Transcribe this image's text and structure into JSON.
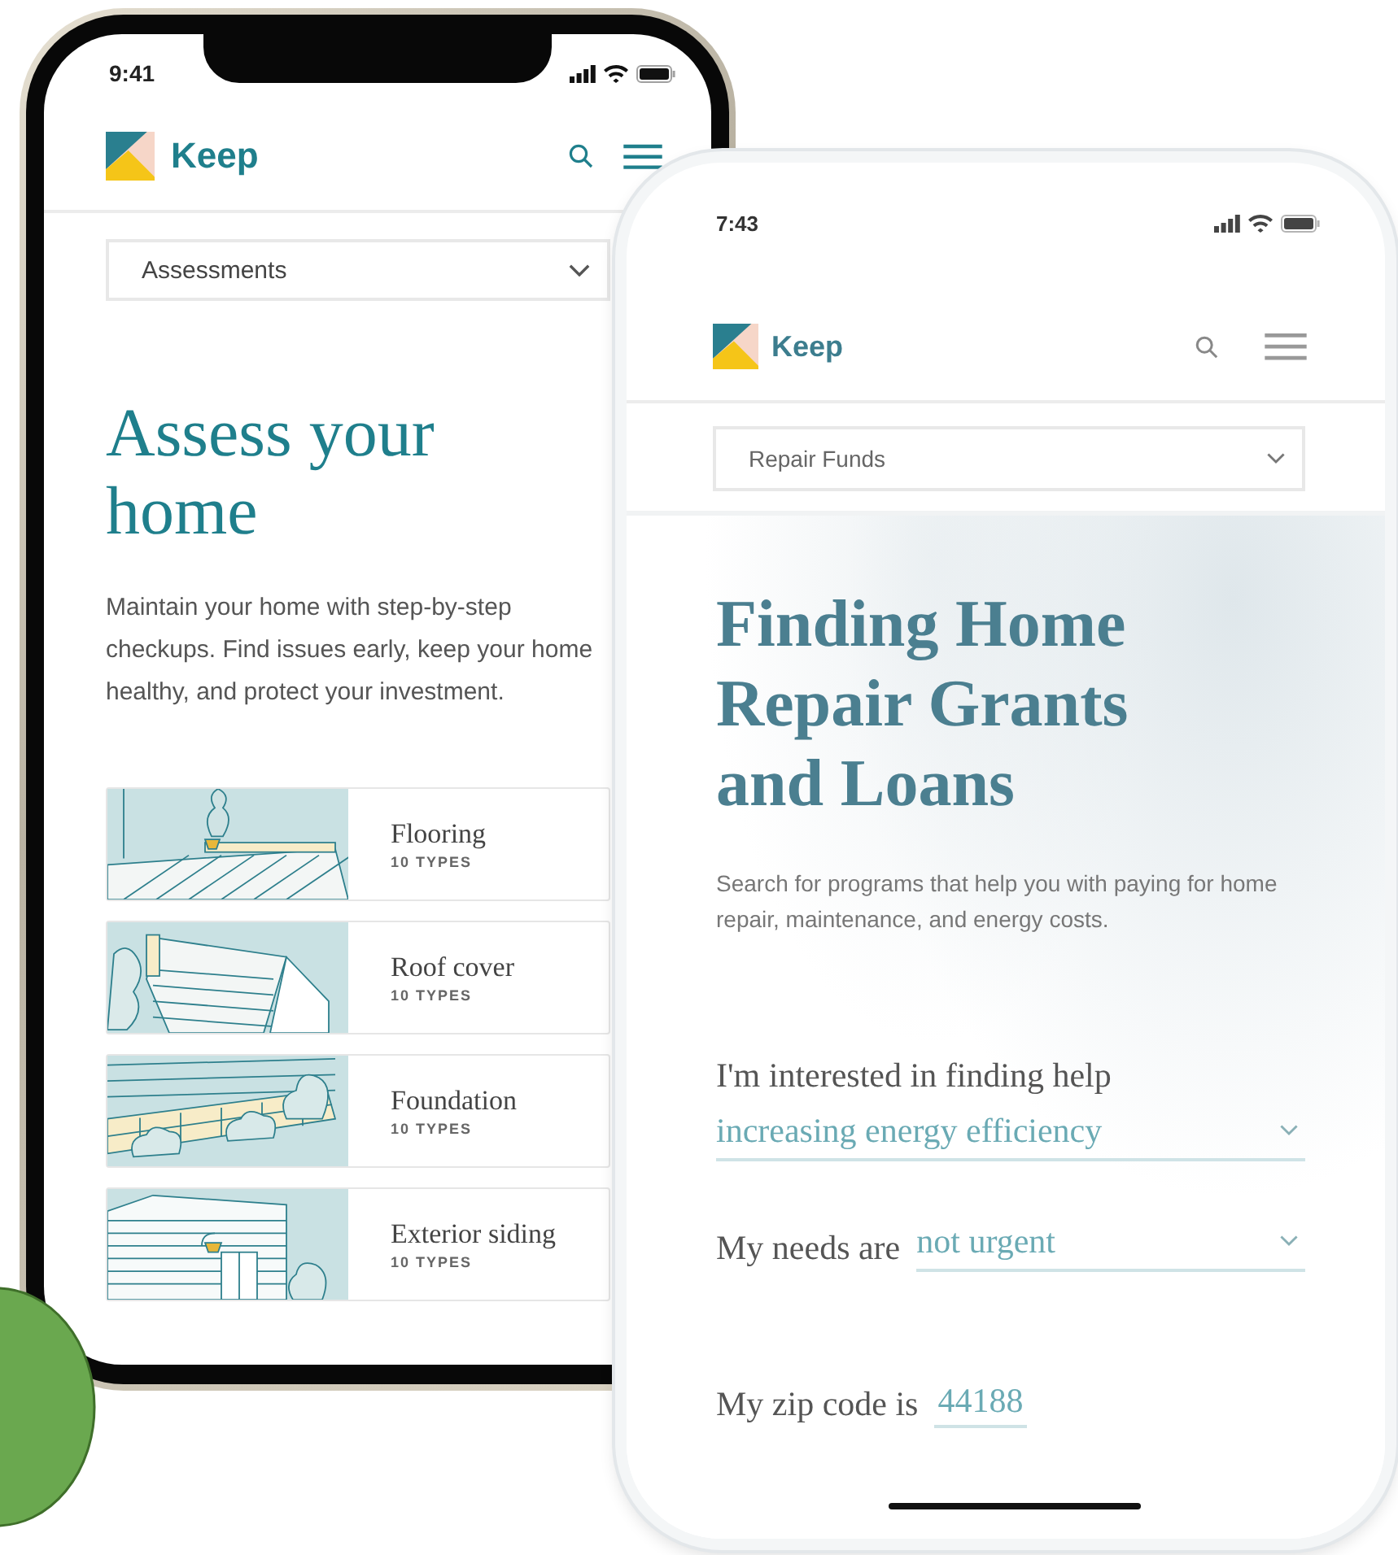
{
  "assess_phone": {
    "status_time": "9:41",
    "brand": "Keep",
    "dropdown": "Assessments",
    "heading": "Assess your home",
    "intro": "Maintain your home with step-by-step checkups. Find issues early, keep your home healthy, and protect your investment.",
    "cards": [
      {
        "title": "Flooring",
        "subtitle": "10 TYPES",
        "kind": "floor"
      },
      {
        "title": "Roof cover",
        "subtitle": "10 TYPES",
        "kind": "roof"
      },
      {
        "title": "Foundation",
        "subtitle": "10 TYPES",
        "kind": "foundation"
      },
      {
        "title": "Exterior siding",
        "subtitle": "10 TYPES",
        "kind": "siding"
      }
    ]
  },
  "repair_phone": {
    "status_time": "7:43",
    "brand": "Keep",
    "dropdown": "Repair Funds",
    "heading": "Finding Home Repair Grants and Loans",
    "intro": "Search for programs that help you with paying for home repair, maintenance, and energy costs.",
    "form": [
      {
        "kind": "stacked-select",
        "label": "I'm interested in finding help",
        "value": "increasing energy efficiency"
      },
      {
        "kind": "inline-select",
        "label": "My needs are",
        "value": "not urgent"
      },
      {
        "kind": "inline-text",
        "label": "My zip code is",
        "value": "44188"
      }
    ]
  }
}
